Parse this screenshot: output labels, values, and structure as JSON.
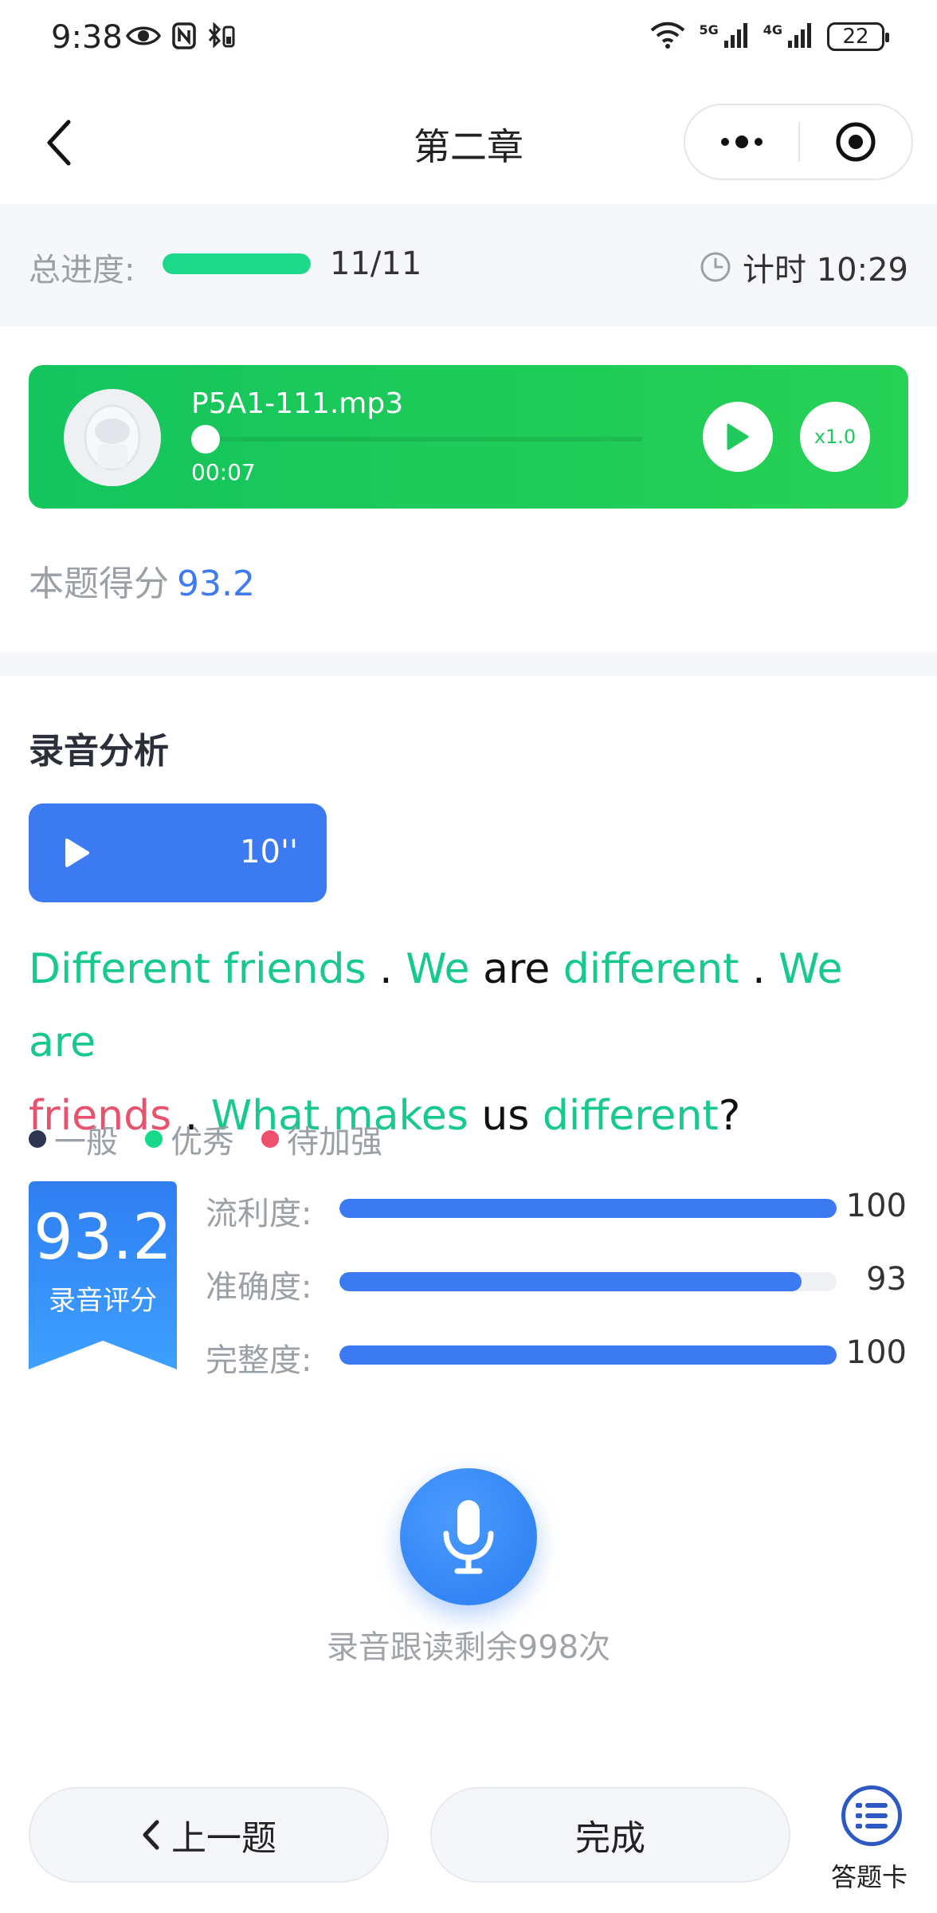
{
  "status_bar": {
    "time": "9:38",
    "network_5g": "5G",
    "network_4g": "4G",
    "battery": "22"
  },
  "nav": {
    "title": "第二章"
  },
  "progress": {
    "label": "总进度:",
    "count": "11/11",
    "fraction": 1.0,
    "timer": "计时 10:29"
  },
  "audio": {
    "file_name": "P5A1-111.mp3",
    "current_time": "00:07",
    "speed": "x1.0",
    "position_fraction": 0.0
  },
  "score": {
    "label": "本题得分",
    "value": "93.2"
  },
  "analysis": {
    "title": "录音分析",
    "recording_duration": "10''",
    "sentence_line1": [
      {
        "text": "Different friends",
        "level": "good"
      },
      {
        "text": " . ",
        "level": "normal"
      },
      {
        "text": "We",
        "level": "good"
      },
      {
        "text": " are ",
        "level": "normal"
      },
      {
        "text": "different",
        "level": "good"
      },
      {
        "text": " . ",
        "level": "normal"
      },
      {
        "text": "We are",
        "level": "good"
      }
    ],
    "sentence_line2": [
      {
        "text": "friends",
        "level": "weak"
      },
      {
        "text": " . ",
        "level": "normal"
      },
      {
        "text": "What makes",
        "level": "good"
      },
      {
        "text": " us ",
        "level": "normal"
      },
      {
        "text": "different",
        "level": "good"
      },
      {
        "text": "?",
        "level": "normal"
      }
    ],
    "legend": [
      {
        "label": "一般",
        "color": "#2d3650"
      },
      {
        "label": "优秀",
        "color": "#17d98a"
      },
      {
        "label": "待加强",
        "color": "#f0506e"
      }
    ],
    "badge": {
      "score": "93.2",
      "label": "录音评分"
    },
    "metrics": [
      {
        "label": "流利度:",
        "value": "100",
        "fraction": 1.0
      },
      {
        "label": "准确度:",
        "value": "93",
        "fraction": 0.93
      },
      {
        "label": "完整度:",
        "value": "100",
        "fraction": 1.0
      }
    ]
  },
  "mic": {
    "caption": "录音跟读剩余998次"
  },
  "bottom": {
    "prev_label": "上一题",
    "done_label": "完成",
    "answer_card_label": "答题卡"
  },
  "colors": {
    "accent_blue": "#3b7af0",
    "green": "#17c98a",
    "weak_red": "#e8526e",
    "audio_green": "#14c45e"
  }
}
